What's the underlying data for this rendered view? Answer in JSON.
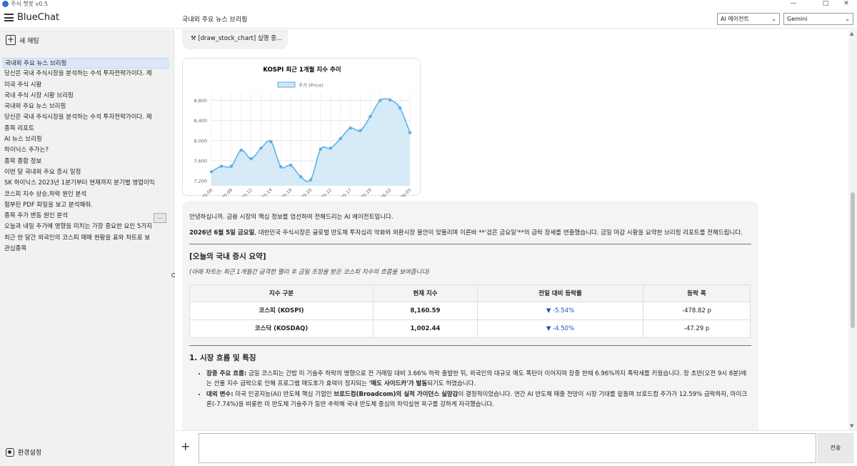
{
  "window": {
    "title": "주식 챗봇 v0.5"
  },
  "header": {
    "app_name": "BlueChat",
    "chat_title": "국내외 주요 뉴스 브리핑",
    "agent_select": "AI 에이전트",
    "model_select": "Gemini"
  },
  "sidebar": {
    "new_chat": "새 채팅",
    "settings": "환경설정",
    "more_label": "...",
    "items": [
      "국내외 주요 뉴스 브리핑",
      "당신은 국내 주식시장을 분석하는 수석 투자전략가이다. 제",
      "미국 주식 시황",
      "국내 주식 시장 시황 브리핑",
      "국내외 주요 뉴스 브리핑",
      "당신은 국내 주식시장을 분석하는 수석 투자전략가이다. 제",
      "종목 리포트",
      "AI 뉴스 브리핑",
      "하이닉스 주가는?",
      "종목 종합 정보",
      "이번 달 국내외 주요 증시 일정",
      "SK 하이닉스 2023년 1분기부터 현재까지 분기별 영업이익",
      "코스피 지수 상승,하락 원인 분석",
      "첨부된 PDF 파일을 보고 분석해줘.",
      "종목 주가 변동 원인 분석",
      "오늘과 내일 주가에 영향을 미치는 가장 중요한 요인 5가지",
      "최근 한 달간 외국인의 코스피 매매 현황을 표와 차트로 보",
      "관심종목"
    ]
  },
  "tool_status": "[draw_stock_chart] 실행 중...",
  "chart_data": {
    "type": "area",
    "title": "KOSPI 최근 1개월 지수 추이",
    "legend": "주가 (Price)",
    "x": [
      "2026-05-06",
      "2026-05-07",
      "2026-05-08",
      "2026-05-11",
      "2026-05-12",
      "2026-05-13",
      "2026-05-14",
      "2026-05-15",
      "2026-05-18",
      "2026-05-19",
      "2026-05-20",
      "2026-05-21",
      "2026-05-22",
      "2026-05-26",
      "2026-05-27",
      "2026-05-28",
      "2026-05-29",
      "2026-06-01",
      "2026-06-02",
      "2026-06-04",
      "2026-06-05"
    ],
    "x_tick_labels": [
      "2026-05-06",
      "2026-05-08",
      "2026-05-12",
      "2026-05-14",
      "2026-05-18",
      "2026-05-20",
      "2026-05-22",
      "2026-05-27",
      "2026-05-29",
      "2026-06-02",
      "2026-06-05"
    ],
    "values": [
      7380,
      7490,
      7490,
      7810,
      7640,
      7850,
      7980,
      7480,
      7510,
      7280,
      7220,
      7830,
      7850,
      8040,
      8250,
      8200,
      8480,
      8800,
      8810,
      8650,
      8160
    ],
    "ylim": [
      7100,
      8950
    ],
    "y_ticks": [
      7200,
      7600,
      8000,
      8400,
      8800
    ],
    "y_tick_labels": [
      "7,200",
      "7,600",
      "8,000",
      "8,400",
      "8,800"
    ],
    "color": "#5aaee6",
    "fill": "#cfe6f6",
    "grid": true
  },
  "message": {
    "greeting": "안녕하십니까. 금융 시장의 핵심 정보를 엄선하여 전해드리는 AI 에이전트입니다.",
    "intro_bold": "2026년 6월 5일 금요일",
    "intro_rest": ", 대한민국 주식시장은 글로벌 반도체 투자심리 악화와 외환시장 불안이 맞물리며 이른바 **'검은 금요일'**의 급락 장세를 연출했습니다. 금일 마감 시황을 요약한 브리핑 리포트를 전해드립니다.",
    "section_title": "[오늘의 국내 증시 요약]",
    "note": "(아래 차트는 최근 1개월간 급격한 랠리 후 금일 조정을 받은 코스피 지수의 흐름을 보여줍니다)",
    "table": {
      "headers": [
        "지수 구분",
        "현재 지수",
        "전일 대비 등락률",
        "등락 폭"
      ],
      "rows": [
        {
          "name": "코스피 (KOSPI)",
          "value": "8,160.59",
          "change": "▼ -5.54%",
          "diff": "-478.82 p"
        },
        {
          "name": "코스닥 (KOSDAQ)",
          "value": "1,002.44",
          "change": "▼ -4.50%",
          "diff": "-47.29 p"
        }
      ]
    },
    "heading1": "1. 시장 흐름 및 특징",
    "bullets": [
      {
        "label": "장중 주요 흐름:",
        "text1": " 금일 코스피는 간밤 미 기술주 하락의 영향으로 전 거래일 대비 3.66% 하락 출발한 뒤, 외국인의 대규모 매도 폭탄이 이어지며 장중 한때 6.96%까지 폭락세를 키웠습니다. 장 초반(오전 9시 8분)에는 선물 지수 급락으로 인해 프로그램 매도호가 효력이 정지되는 ",
        "bold2": "'매도 사이드카'가 발동",
        "text2": "되기도 하였습니다."
      },
      {
        "label": "대외 변수:",
        "text1": " 미국 인공지능(AI) 반도체 핵심 기업인 ",
        "bold2": "브로드컴(Broadcom)의 실적 가이던스 실망감",
        "text2": "이 결정적이었습니다. 연간 AI 반도체 매출 전망이 시장 기대를 밑돌며 브로드컴 주가가 12.59% 급락하자, 마이크론(-7.74%)을 비롯한 미 반도체 기술주가 동반 추락해 국내 반도체 중심의 차익실현 욕구를 강하게 자극했습니다."
      }
    ]
  },
  "input": {
    "send": "전송",
    "plus": "+"
  }
}
